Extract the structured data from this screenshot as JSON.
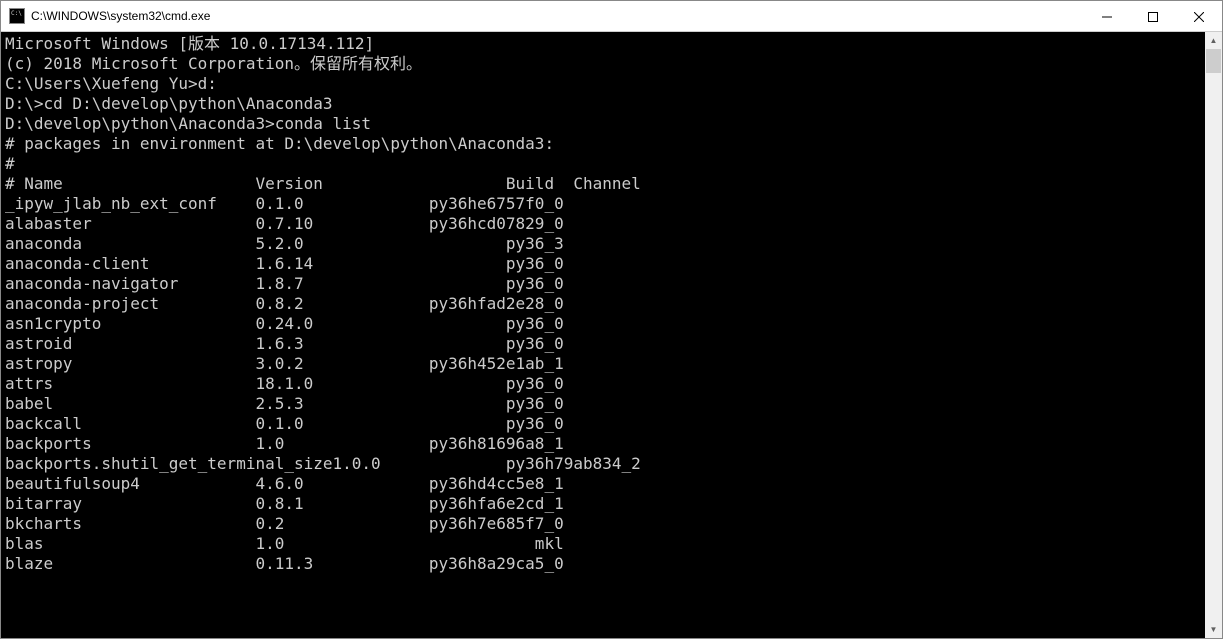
{
  "window": {
    "title": "C:\\WINDOWS\\system32\\cmd.exe"
  },
  "terminal": {
    "headerLines": [
      "Microsoft Windows [版本 10.0.17134.112]",
      "(c) 2018 Microsoft Corporation。保留所有权利。",
      "",
      "C:\\Users\\Xuefeng Yu>d:",
      "",
      "D:\\>cd D:\\develop\\python\\Anaconda3",
      "",
      "D:\\develop\\python\\Anaconda3>conda list",
      "# packages in environment at D:\\develop\\python\\Anaconda3:",
      "#",
      "# Name                    Version                   Build  Channel"
    ],
    "packages": [
      {
        "name": "_ipyw_jlab_nb_ext_conf",
        "version": "0.1.0",
        "build": "py36he6757f0_0",
        "channel": ""
      },
      {
        "name": "alabaster",
        "version": "0.7.10",
        "build": "py36hcd07829_0",
        "channel": ""
      },
      {
        "name": "anaconda",
        "version": "5.2.0",
        "build": "py36_3",
        "channel": ""
      },
      {
        "name": "anaconda-client",
        "version": "1.6.14",
        "build": "py36_0",
        "channel": ""
      },
      {
        "name": "anaconda-navigator",
        "version": "1.8.7",
        "build": "py36_0",
        "channel": ""
      },
      {
        "name": "anaconda-project",
        "version": "0.8.2",
        "build": "py36hfad2e28_0",
        "channel": ""
      },
      {
        "name": "asn1crypto",
        "version": "0.24.0",
        "build": "py36_0",
        "channel": ""
      },
      {
        "name": "astroid",
        "version": "1.6.3",
        "build": "py36_0",
        "channel": ""
      },
      {
        "name": "astropy",
        "version": "3.0.2",
        "build": "py36h452e1ab_1",
        "channel": ""
      },
      {
        "name": "attrs",
        "version": "18.1.0",
        "build": "py36_0",
        "channel": ""
      },
      {
        "name": "babel",
        "version": "2.5.3",
        "build": "py36_0",
        "channel": ""
      },
      {
        "name": "backcall",
        "version": "0.1.0",
        "build": "py36_0",
        "channel": ""
      },
      {
        "name": "backports",
        "version": "1.0",
        "build": "py36h81696a8_1",
        "channel": ""
      },
      {
        "name": "backports.shutil_get_terminal_size",
        "version": "1.0.0",
        "build": "py36h79ab834_2",
        "channel": ""
      },
      {
        "name": "beautifulsoup4",
        "version": "4.6.0",
        "build": "py36hd4cc5e8_1",
        "channel": ""
      },
      {
        "name": "bitarray",
        "version": "0.8.1",
        "build": "py36hfa6e2cd_1",
        "channel": ""
      },
      {
        "name": "bkcharts",
        "version": "0.2",
        "build": "py36h7e685f7_0",
        "channel": ""
      },
      {
        "name": "blas",
        "version": "1.0",
        "build": "mkl",
        "channel": ""
      },
      {
        "name": "blaze",
        "version": "0.11.3",
        "build": "py36h8a29ca5_0",
        "channel": ""
      }
    ]
  }
}
